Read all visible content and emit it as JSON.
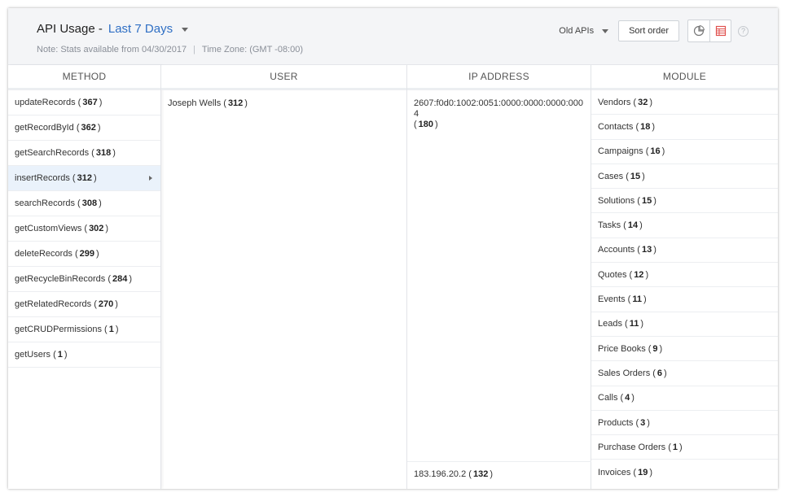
{
  "header": {
    "title": "API Usage -",
    "period": "Last 7 Days",
    "note": "Note: Stats available from 04/30/2017",
    "separator": "|",
    "timezone": "Time Zone: (GMT -08:00)",
    "old_apis": "Old APIs",
    "sort_order": "Sort order",
    "help": "?"
  },
  "columns": {
    "method": "Method",
    "user": "User",
    "ip": "IP Address",
    "module": "Module"
  },
  "methods": [
    {
      "name": "updateRecords",
      "count": "367"
    },
    {
      "name": "getRecordById",
      "count": "362"
    },
    {
      "name": "getSearchRecords",
      "count": "318"
    },
    {
      "name": "insertRecords",
      "count": "312"
    },
    {
      "name": "searchRecords",
      "count": "308"
    },
    {
      "name": "getCustomViews",
      "count": "302"
    },
    {
      "name": "deleteRecords",
      "count": "299"
    },
    {
      "name": "getRecycleBinRecords",
      "count": "284"
    },
    {
      "name": "getRelatedRecords",
      "count": "270"
    },
    {
      "name": "getCRUDPermissions",
      "count": "1"
    },
    {
      "name": "getUsers",
      "count": "1"
    }
  ],
  "selected_method_index": 3,
  "users": [
    {
      "name": "Joseph Wells",
      "count": "312"
    }
  ],
  "ips": [
    {
      "address": "2607:f0d0:1002:0051:0000:0000:0000:0004",
      "count": "180"
    },
    {
      "address": "183.196.20.2",
      "count": "132"
    }
  ],
  "modules": [
    {
      "name": "Vendors",
      "count": "32"
    },
    {
      "name": "Contacts",
      "count": "18"
    },
    {
      "name": "Campaigns",
      "count": "16"
    },
    {
      "name": "Cases",
      "count": "15"
    },
    {
      "name": "Solutions",
      "count": "15"
    },
    {
      "name": "Tasks",
      "count": "14"
    },
    {
      "name": "Accounts",
      "count": "13"
    },
    {
      "name": "Quotes",
      "count": "12"
    },
    {
      "name": "Events",
      "count": "11"
    },
    {
      "name": "Leads",
      "count": "11"
    },
    {
      "name": "Price Books",
      "count": "9"
    },
    {
      "name": "Sales Orders",
      "count": "6"
    },
    {
      "name": "Calls",
      "count": "4"
    },
    {
      "name": "Products",
      "count": "3"
    },
    {
      "name": "Purchase Orders",
      "count": "1"
    },
    {
      "name": "Invoices",
      "count": "19"
    }
  ],
  "colors": {
    "accent": "#2f6fc4",
    "selected_row": "#eaf2fb",
    "table_view_icon": "#e0524f"
  }
}
